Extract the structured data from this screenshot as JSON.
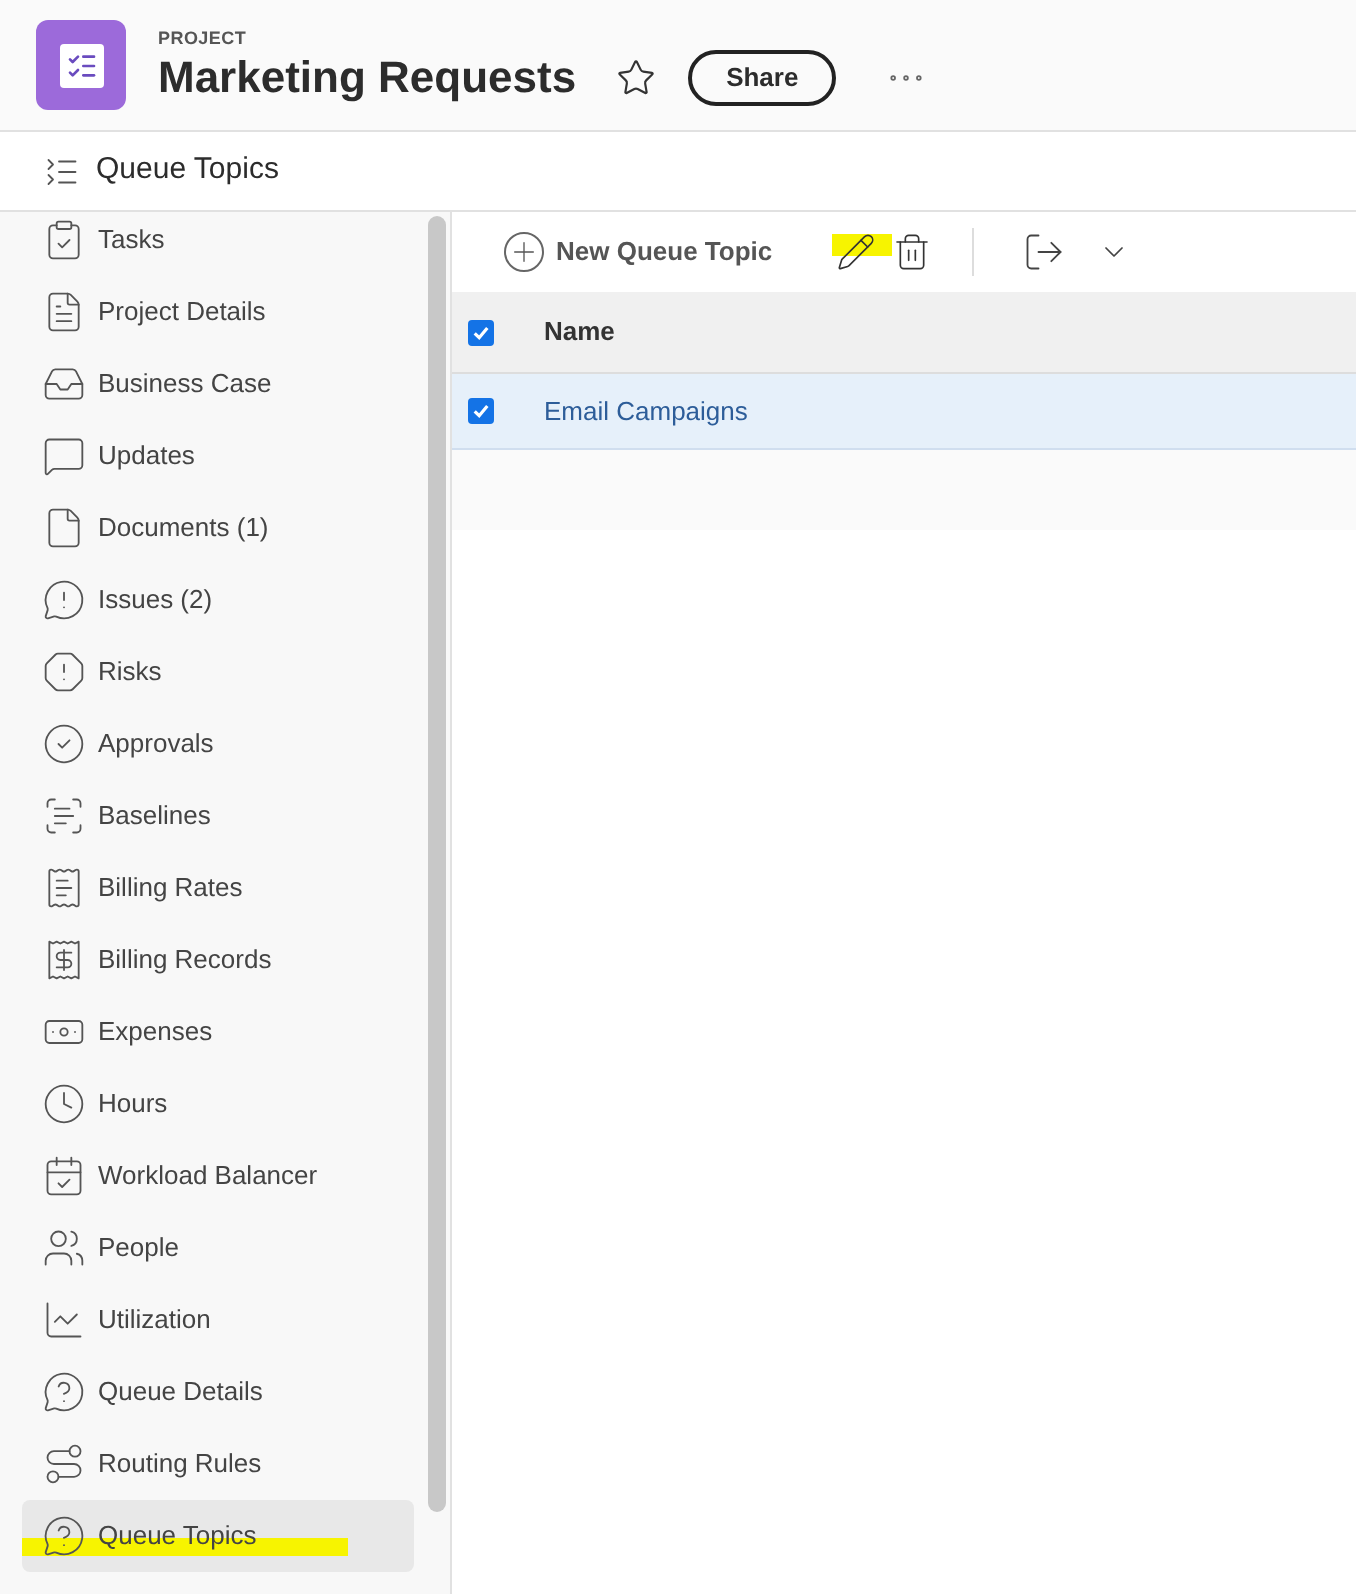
{
  "header": {
    "eyebrow": "PROJECT",
    "title": "Marketing Requests",
    "favorite": false,
    "share_button": "Share"
  },
  "breadcrumb": {
    "title": "Queue Topics"
  },
  "sidebar": {
    "items": [
      {
        "label": "Tasks",
        "selected": false
      },
      {
        "label": "Project Details",
        "selected": false
      },
      {
        "label": "Business Case",
        "selected": false
      },
      {
        "label": "Updates",
        "selected": false
      },
      {
        "label": "Documents (1)",
        "selected": false
      },
      {
        "label": "Issues (2)",
        "selected": false
      },
      {
        "label": "Risks",
        "selected": false
      },
      {
        "label": "Approvals",
        "selected": false
      },
      {
        "label": "Baselines",
        "selected": false
      },
      {
        "label": "Billing Rates",
        "selected": false
      },
      {
        "label": "Billing Records",
        "selected": false
      },
      {
        "label": "Expenses",
        "selected": false
      },
      {
        "label": "Hours",
        "selected": false
      },
      {
        "label": "Workload Balancer",
        "selected": false
      },
      {
        "label": "People",
        "selected": false
      },
      {
        "label": "Utilization",
        "selected": false
      },
      {
        "label": "Queue Details",
        "selected": false
      },
      {
        "label": "Routing Rules",
        "selected": false
      },
      {
        "label": "Queue Topics",
        "selected": true
      }
    ]
  },
  "toolbar": {
    "new_button": "New Queue Topic"
  },
  "table": {
    "header_checked": true,
    "columns": [
      "Name"
    ],
    "rows": [
      {
        "name": "Email Campaigns",
        "checked": true
      }
    ]
  }
}
